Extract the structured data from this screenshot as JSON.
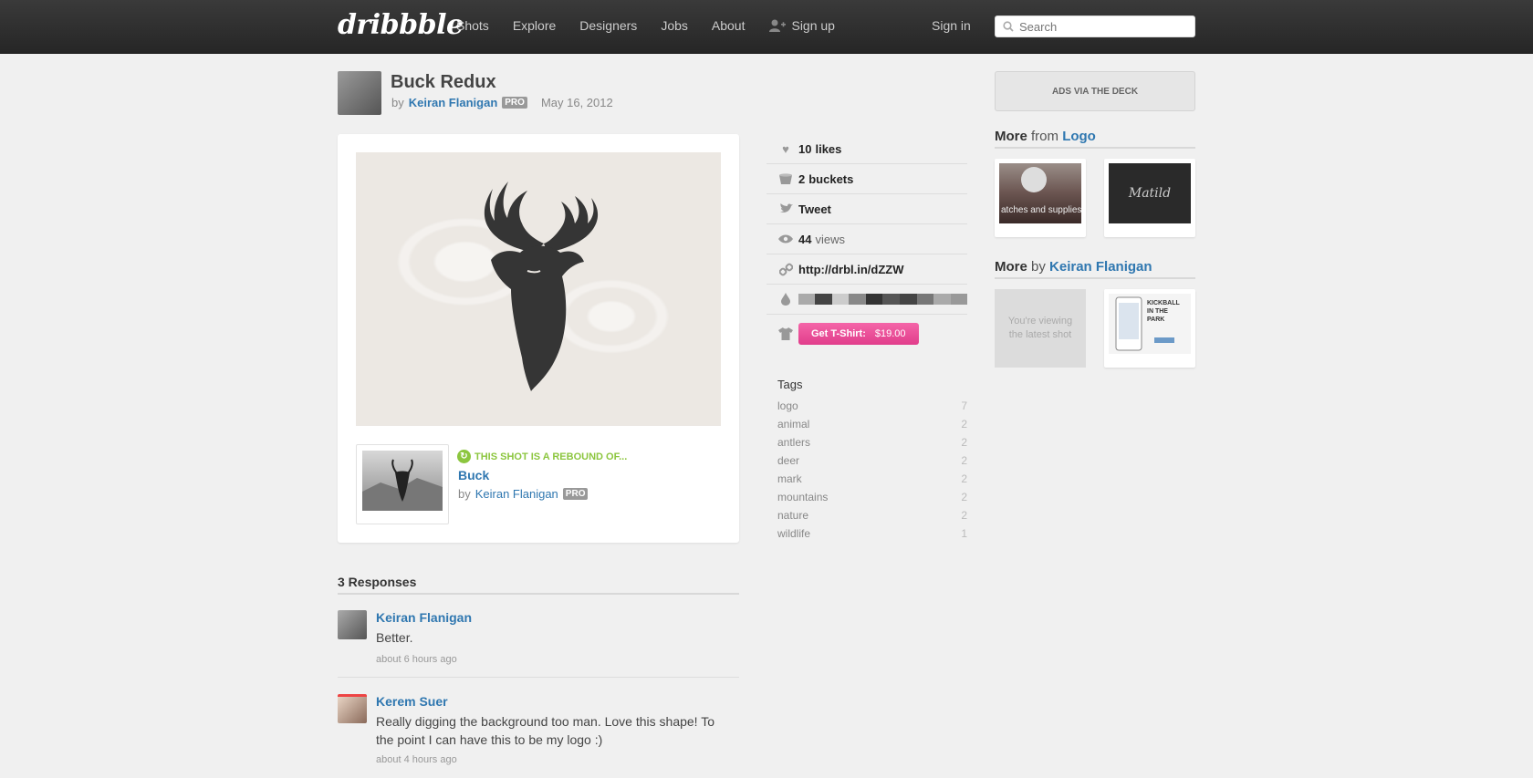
{
  "header": {
    "logo": "dribbble",
    "nav": [
      "Shots",
      "Explore",
      "Designers",
      "Jobs",
      "About"
    ],
    "signup": "Sign up",
    "signin": "Sign in",
    "search_placeholder": "Search"
  },
  "shot": {
    "title": "Buck Redux",
    "by": "by",
    "author": "Keiran Flanigan",
    "pro": "PRO",
    "date": "May 16, 2012"
  },
  "rebound": {
    "label": "THIS SHOT IS A REBOUND OF...",
    "title": "Buck",
    "by": "by",
    "author": "Keiran Flanigan",
    "pro": "PRO"
  },
  "meta": {
    "likes_count": "10",
    "likes_label": "likes",
    "buckets_count": "2",
    "buckets_label": "buckets",
    "tweet": "Tweet",
    "views_count": "44",
    "views_label": "views",
    "short_url": "http://drbl.in/dZZW",
    "palette": [
      "#aaaaaa",
      "#444444",
      "#cccccc",
      "#888888",
      "#333333",
      "#555555",
      "#444444",
      "#777777",
      "#aaaaaa",
      "#999999"
    ],
    "tshirt_label": "Get T-Shirt:",
    "tshirt_price": "$19.00"
  },
  "tags": {
    "title": "Tags",
    "items": [
      {
        "name": "logo",
        "count": "7"
      },
      {
        "name": "animal",
        "count": "2"
      },
      {
        "name": "antlers",
        "count": "2"
      },
      {
        "name": "deer",
        "count": "2"
      },
      {
        "name": "mark",
        "count": "2"
      },
      {
        "name": "mountains",
        "count": "2"
      },
      {
        "name": "nature",
        "count": "2"
      },
      {
        "name": "wildlife",
        "count": "1"
      }
    ]
  },
  "responses": {
    "title": "3 Responses",
    "items": [
      {
        "name": "Keiran Flanigan",
        "text": "Better.",
        "time": "about 6 hours ago"
      },
      {
        "name": "Kerem Suer",
        "text": "Really digging the background too man. Love this shape! To the point I can have this to be my logo :)",
        "time": "about 4 hours ago"
      }
    ]
  },
  "sidebar": {
    "ads": "ADS VIA THE DECK",
    "more_from_bold": "More",
    "more_from_text": "from",
    "more_from_link": "Logo",
    "more_by_bold": "More",
    "more_by_text": "by",
    "more_by_link": "Keiran Flanigan",
    "latest_text": "You're viewing the latest shot",
    "thumb1_text": "atches and supplies",
    "thumb2_text": "Matild",
    "thumb4_text": "KICKBALL IN THE PARK"
  },
  "colors": {
    "link": "#2f77b0",
    "rebound": "#8cc63f",
    "tshirt_button": "#e13d8b"
  }
}
